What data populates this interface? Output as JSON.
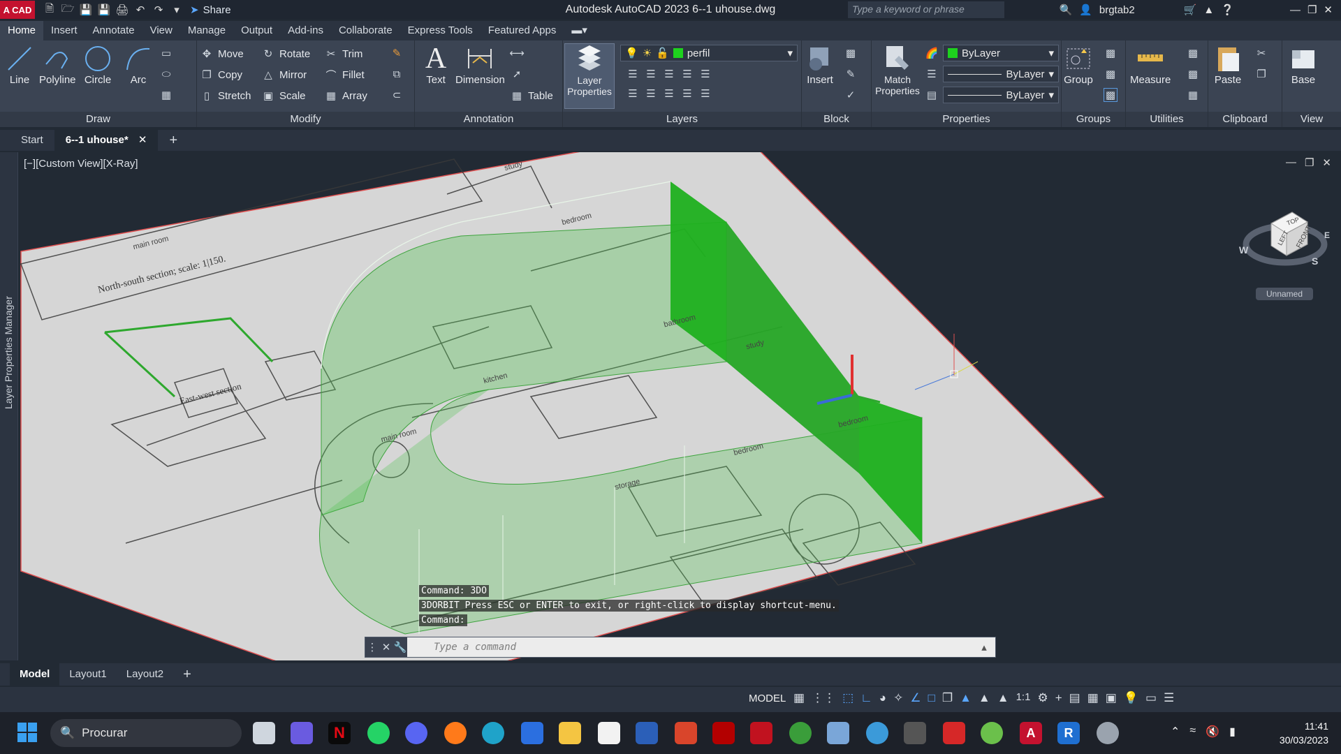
{
  "titlebar": {
    "logo": "A CAD",
    "share_label": "Share",
    "title": "Autodesk AutoCAD 2023   6--1 uhouse.dwg",
    "search_placeholder": "Type a keyword or phrase",
    "user": "brgtab2"
  },
  "menu_tabs": [
    "Home",
    "Insert",
    "Annotate",
    "View",
    "Manage",
    "Output",
    "Add-ins",
    "Collaborate",
    "Express Tools",
    "Featured Apps"
  ],
  "ribbon": {
    "draw": {
      "title": "Draw",
      "line": "Line",
      "polyline": "Polyline",
      "circle": "Circle",
      "arc": "Arc"
    },
    "modify": {
      "title": "Modify",
      "move": "Move",
      "rotate": "Rotate",
      "trim": "Trim",
      "copy": "Copy",
      "mirror": "Mirror",
      "fillet": "Fillet",
      "stretch": "Stretch",
      "scale": "Scale",
      "array": "Array"
    },
    "annotation": {
      "title": "Annotation",
      "text": "Text",
      "dimension": "Dimension",
      "table": "Table"
    },
    "layers": {
      "title": "Layers",
      "layer_properties": "Layer Properties",
      "current_layer": "perfil"
    },
    "block": {
      "title": "Block",
      "insert": "Insert"
    },
    "properties": {
      "title": "Properties",
      "match": "Match Properties",
      "color": "ByLayer",
      "linetype": "ByLayer",
      "lineweight": "ByLayer"
    },
    "groups": {
      "title": "Groups",
      "group": "Group"
    },
    "utilities": {
      "title": "Utilities",
      "measure": "Measure"
    },
    "clipboard": {
      "title": "Clipboard",
      "paste": "Paste"
    },
    "view": {
      "title": "View",
      "base": "Base"
    }
  },
  "file_tabs": {
    "start": "Start",
    "current": "6--1 uhouse*"
  },
  "viewport": {
    "side_panel_label": "Layer Properties Manager",
    "view_label": "[−][Custom View][X-Ray]",
    "viewcube_label": "Unnamed",
    "viewcube_faces": {
      "front": "FRONT",
      "left": "LEFT",
      "top": "TOP"
    },
    "compass": {
      "w": "W",
      "s": "S",
      "e": "E"
    },
    "drawing_text": {
      "ns_section": "North-south section; scale: 1|150.",
      "ew_section": "East-west section",
      "main_room_1": "main room",
      "main_room_2": "main room",
      "bathroom": "bathroom",
      "study_1": "study",
      "study_2": "study",
      "kitchen": "kitchen",
      "bedroom_1": "bedroom",
      "bedroom_2": "bedroom",
      "bedroom_3": "bedroom",
      "storage": "storage"
    }
  },
  "command": {
    "history": [
      "Command: 3DO",
      "3DORBIT Press ESC or ENTER to exit, or right-click to display shortcut-menu.",
      "Command:"
    ],
    "placeholder": "Type a command"
  },
  "layout_tabs": [
    "Model",
    "Layout1",
    "Layout2"
  ],
  "status": {
    "mode": "MODEL",
    "scale": "1:1"
  },
  "taskbar": {
    "search": "Procurar",
    "time": "11:41",
    "date": "30/03/2023"
  },
  "colors": {
    "accent_green": "#22b022",
    "app_red": "#c4122f",
    "ribbon_bg": "#3b4453"
  }
}
